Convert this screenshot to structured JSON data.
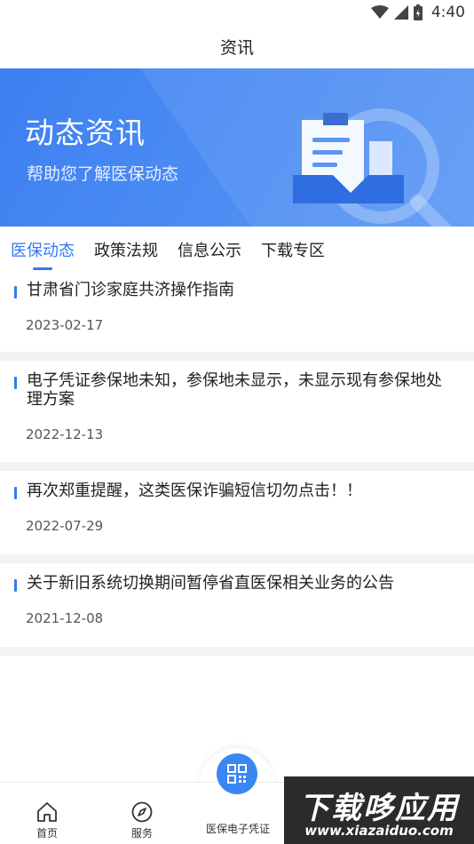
{
  "status_bar": {
    "time": "4:40",
    "icons": [
      "wifi-icon",
      "signal-icon",
      "battery-icon"
    ]
  },
  "header": {
    "title": "资讯"
  },
  "banner": {
    "title": "动态资讯",
    "subtitle": "帮助您了解医保动态"
  },
  "tabs": [
    {
      "label": "医保动态",
      "active": true
    },
    {
      "label": "政策法规",
      "active": false
    },
    {
      "label": "信息公示",
      "active": false
    },
    {
      "label": "下载专区",
      "active": false
    }
  ],
  "news": [
    {
      "title": "甘肃省门诊家庭共济操作指南",
      "date": "2023-02-17"
    },
    {
      "title": "电子凭证参保地未知，参保地未显示，未显示现有参保地处理方案",
      "date": "2022-12-13"
    },
    {
      "title": "再次郑重提醒，这类医保诈骗短信切勿点击！！",
      "date": "2022-07-29"
    },
    {
      "title": "关于新旧系统切换期间暂停省直医保相关业务的公告",
      "date": "2021-12-08"
    }
  ],
  "bottom_nav": {
    "home_label": "首页",
    "service_label": "服务",
    "center_label": "医保电子凭证"
  },
  "watermark": {
    "brand": "下载哆应用",
    "url": "www.xiazaiduo.com"
  },
  "colors": {
    "accent": "#3478f6",
    "banner": "#4a8bf3",
    "separator": "#f2f3f5"
  }
}
